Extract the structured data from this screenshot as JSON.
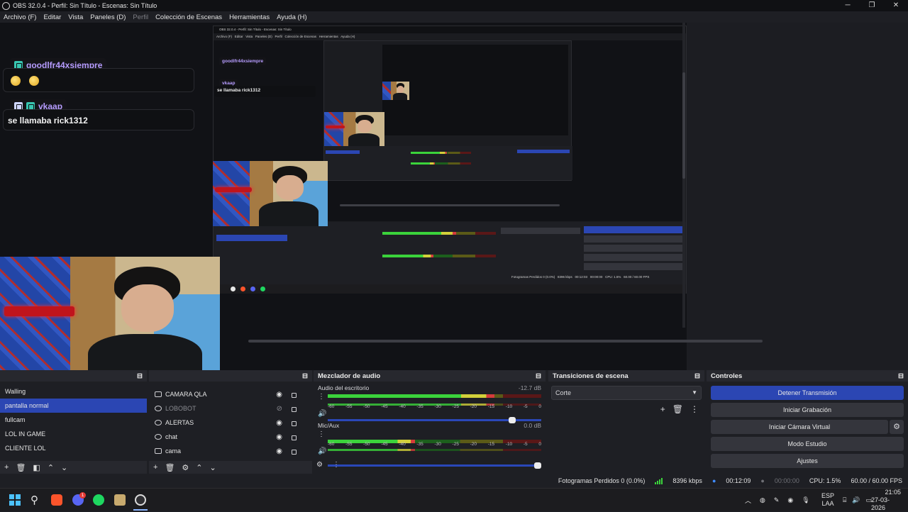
{
  "window": {
    "title": "OBS 32.0.4 - Perfil: Sin Título - Escenas: Sin Título"
  },
  "menu": {
    "items": [
      "Archivo (F)",
      "Editar",
      "Vista",
      "Paneles (D)",
      "Perfil",
      "Colección de Escenas",
      "Herramientas",
      "Ayuda (H)"
    ]
  },
  "chat": {
    "messages": [
      {
        "user": "goodlfr44xsiempre",
        "text": ""
      },
      {
        "user": "vkaap",
        "text": "se llamaba rick1312"
      }
    ]
  },
  "nested": {
    "title": "OBS 32.0.4 - Perfil: Sin Título - Escenas: Sin Título",
    "menu": "Archivo (F)   Editar   Vista   Paneles (D)   Perfil   Colección de Escenas   Herramientas   Ayuda (H)",
    "chat_user1": "goodlfr44xsiempre",
    "chat_user2": "vkaap",
    "chat_text2": "se llamaba rick1312",
    "status": "Fotogramas Perdidos 0 (0.0%)   8396 kbps   00:12:03   00:00:00   CPU: 1.5%   60.00 / 60.00 FPS"
  },
  "scenes": {
    "items": [
      "Walling",
      "pantalla normal",
      "fullcam",
      "LOL IN GAME",
      "CLIENTE LOL"
    ],
    "selected_index": 1
  },
  "sources": {
    "items": [
      {
        "name": "CAMARA QLA",
        "visible": true,
        "dim": false
      },
      {
        "name": "LOBOBOT",
        "visible": false,
        "dim": true
      },
      {
        "name": "ALERTAS",
        "visible": true,
        "dim": false
      },
      {
        "name": "chat",
        "visible": true,
        "dim": false
      },
      {
        "name": "cama",
        "visible": true,
        "dim": false
      }
    ]
  },
  "mixer": {
    "title": "Mezclador de audio",
    "channels": [
      {
        "name": "Audio del escritorio",
        "db": "-12.7 dB",
        "level": 0.78,
        "volume": 0.88
      },
      {
        "name": "Mic/Aux",
        "db": "0.0 dB",
        "level": 0.41,
        "volume": 1.0
      }
    ],
    "ticks": [
      "-60",
      "-55",
      "-50",
      "-45",
      "-40",
      "-35",
      "-30",
      "-25",
      "-20",
      "-15",
      "-10",
      "-5",
      "0"
    ]
  },
  "transitions": {
    "title": "Transiciones de escena",
    "selected": "Corte"
  },
  "controls": {
    "title": "Controles",
    "buttons": [
      "Detener Transmisión",
      "Iniciar Grabación",
      "Iniciar Cámara Virtual",
      "Modo Estudio",
      "Ajustes"
    ]
  },
  "status": {
    "dropped": "Fotogramas Perdidos 0 (0.0%)",
    "kbps": "8396 kbps",
    "stream_time": "00:12:09",
    "rec_time": "00:00:00",
    "cpu": "CPU: 1.5%",
    "fps": "60.00 / 60.00 FPS"
  },
  "taskbar": {
    "lang": "ESP",
    "layout": "LAA",
    "time": "21:05",
    "date": "27-03-2026",
    "discord_badge": "1"
  },
  "colors": {
    "accent": "#2b46b3",
    "twitch_badge": "#38c6b1",
    "username": "#b69cff"
  }
}
